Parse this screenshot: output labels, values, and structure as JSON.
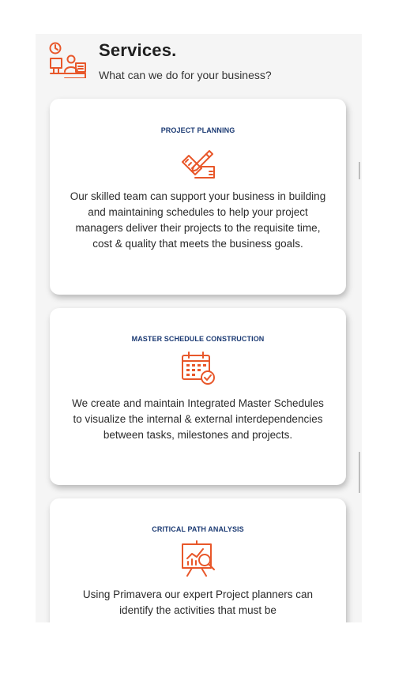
{
  "header": {
    "title": "Services.",
    "subtitle": "What can we do for your business?",
    "icon": "project-planning-team-icon"
  },
  "colors": {
    "accent": "#e8572a",
    "title_blue": "#1b3a73",
    "panel_bg": "#f5f5f5"
  },
  "cards": [
    {
      "title": "PROJECT PLANNING",
      "icon": "ruler-pencil-icon",
      "text": "Our skilled team can support your business in building and maintaining schedules to help your project managers deliver their projects to the requisite time, cost & quality that meets the business goals."
    },
    {
      "title": "MASTER SCHEDULE CONSTRUCTION",
      "icon": "calendar-check-icon",
      "text": "We create and maintain Integrated Master Schedules to visualize the internal & external interdependencies between tasks, milestones and projects."
    },
    {
      "title": "CRITICAL PATH ANALYSIS",
      "icon": "analytics-board-icon",
      "text": "Using Primavera our expert Project planners can identify the activities that must be"
    }
  ]
}
